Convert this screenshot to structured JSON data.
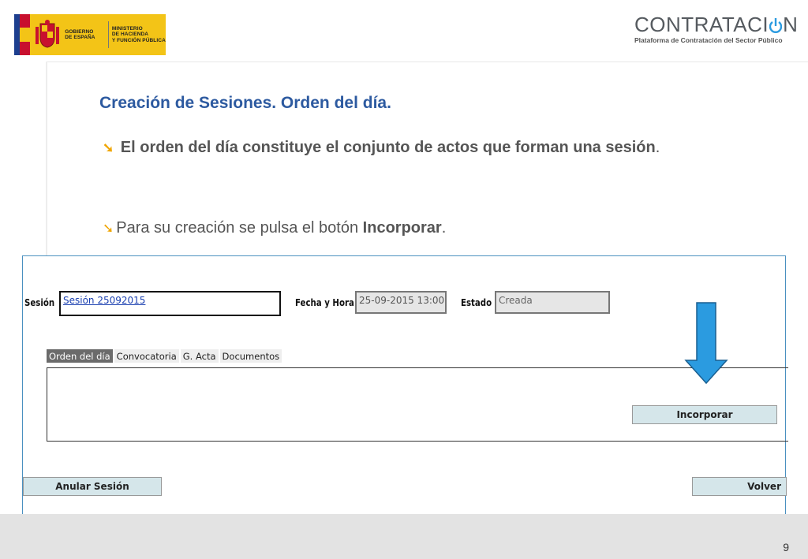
{
  "header": {
    "gov_logo": {
      "left_text": [
        "GOBIERNO",
        "DE ESPAÑA"
      ],
      "right_text": [
        "MINISTERIO",
        "DE HACIENDA",
        "Y FUNCIÓN PÚBLICA"
      ]
    },
    "brand": {
      "name_part1": "CONTRATACI",
      "name_part2": "N",
      "subtitle": "Plataforma de Contratación del Sector Público"
    }
  },
  "slide": {
    "title": "Creación de Sesiones. Orden del día.",
    "bullets": [
      {
        "text": " El orden del día constituye el conjunto de actos que forman una sesión",
        "suffix": "."
      },
      {
        "prefix": "Para su creación se pulsa el botón ",
        "strong": "Incorporar",
        "suffix": "."
      }
    ]
  },
  "screenshot": {
    "session_label": "Sesión",
    "session_value": "Sesión 25092015",
    "date_label": "Fecha y Hora",
    "date_value": "25-09-2015 13:00",
    "estado_label": "Estado",
    "estado_value": "Creada",
    "tabs": [
      "Orden del día",
      "Convocatoria",
      "G. Acta",
      "Documentos"
    ],
    "incorporar_label": "Incorporar",
    "anular_label": "Anular Sesión",
    "volver_label": "Volver"
  },
  "footer": {
    "page_number": "9"
  },
  "colors": {
    "title": "#2d5aa0",
    "bullet_arrow": "#f0a500",
    "logo_yellow": "#f3c417",
    "highlight_arrow": "#2b9be0",
    "button_bg": "#d5e6ea"
  }
}
